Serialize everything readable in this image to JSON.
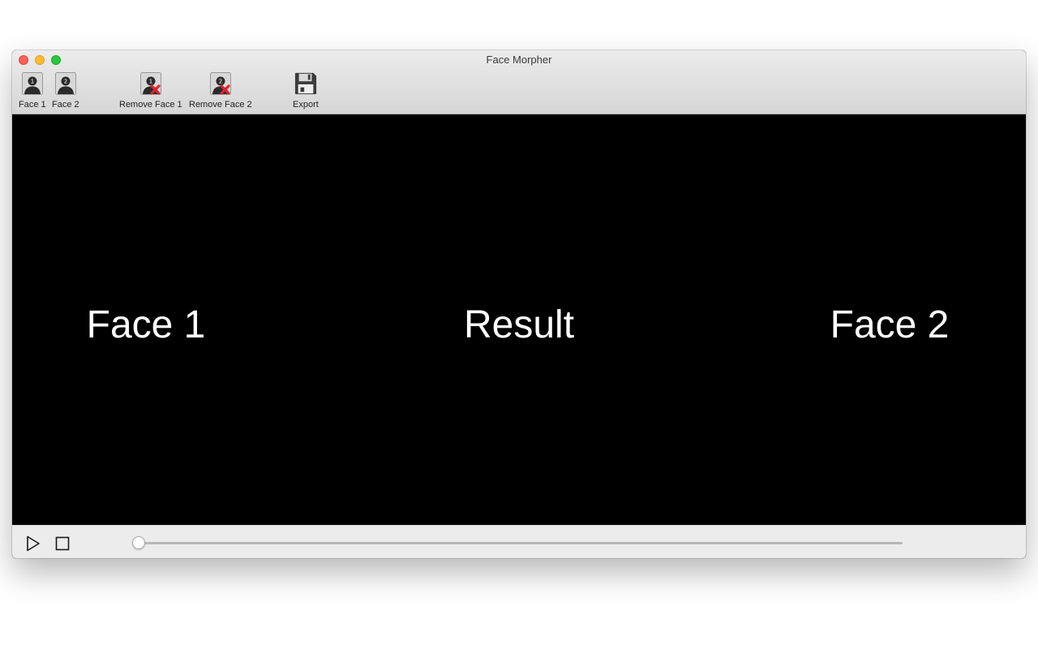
{
  "window": {
    "title": "Face Morpher"
  },
  "toolbar": {
    "items": [
      {
        "label": "Face 1",
        "icon": "face-1-icon",
        "number": "1"
      },
      {
        "label": "Face 2",
        "icon": "face-2-icon",
        "number": "2"
      },
      {
        "label": "Remove Face 1",
        "icon": "remove-face-1-icon",
        "number": "1"
      },
      {
        "label": "Remove Face 2",
        "icon": "remove-face-2-icon",
        "number": "2"
      },
      {
        "label": "Export",
        "icon": "floppy-disk-icon"
      }
    ]
  },
  "stage": {
    "face1_label": "Face 1",
    "result_label": "Result",
    "face2_label": "Face 2",
    "background": "#000000"
  },
  "playback": {
    "play_icon": "play-icon",
    "stop_icon": "stop-icon",
    "slider_value": 0
  },
  "colors": {
    "close": "#fc5f57",
    "minimize": "#fdbc2e",
    "maximize": "#28c840",
    "remove_badge": "#e0242c"
  }
}
